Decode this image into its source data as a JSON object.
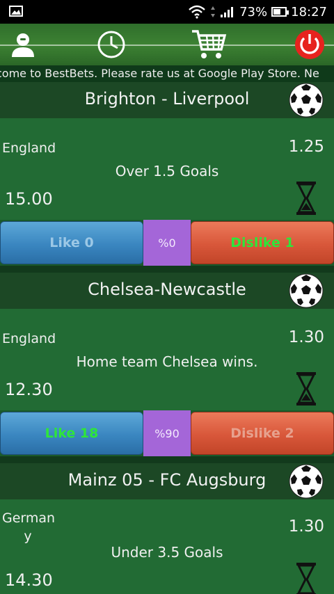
{
  "status_bar": {
    "battery_percent": "73%",
    "time": "18:27"
  },
  "toolbar": {
    "profile_icon": "person-icon",
    "history_icon": "clock-icon",
    "cart_icon": "cart-icon",
    "power_icon": "power-icon"
  },
  "marquee": {
    "text": "come to BestBets. Please rate us at Google Play Store. Ne"
  },
  "matches": [
    {
      "title": "Brighton - Liverpool",
      "country": "England",
      "odds": "1.25",
      "tip": "Over 1.5 Goals",
      "stake": "15.00",
      "like_label": "Like 0",
      "percent": "%0",
      "dislike_label": "Dislike 1",
      "highlight": "dislike"
    },
    {
      "title": "Chelsea-Newcastle",
      "country": "England",
      "odds": "1.30",
      "tip": "Home team Chelsea wins.",
      "stake": "12.30",
      "like_label": "Like 18",
      "percent": "%90",
      "dislike_label": "Dislike 2",
      "highlight": "like"
    },
    {
      "title": "Mainz 05 - FC Augsburg",
      "country": "German\ny",
      "odds": "1.30",
      "tip": "Under 3.5 Goals",
      "stake": "14.30"
    }
  ],
  "colors": {
    "header_bg": "#1c4825",
    "body_bg": "#226b34",
    "like_blue": "#3a86c0",
    "dislike_red": "#d8573a",
    "percent_purple": "#a466d8",
    "highlight_green": "#2ee63a"
  }
}
